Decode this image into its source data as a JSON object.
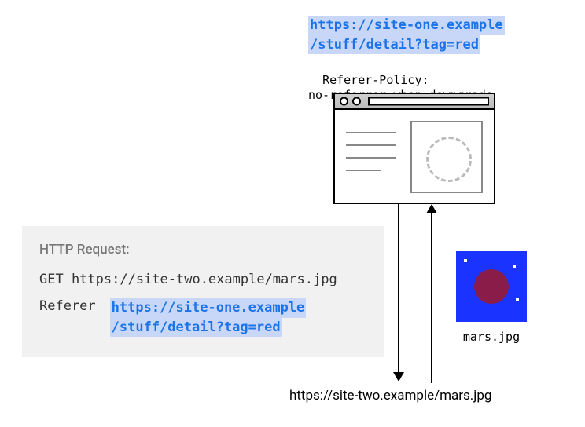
{
  "top": {
    "url_line1": "https://site-one.example",
    "url_line2": "/stuff/detail?tag=red",
    "policy_label": "Referer-Policy:",
    "policy_value": "no-referrer-when-downgrade"
  },
  "request": {
    "heading": "HTTP Request:",
    "method_line": "GET https://site-two.example/mars.jpg",
    "referer_label": "Referer",
    "referer_line1": "https://site-one.example",
    "referer_line2": "/stuff/detail?tag=red"
  },
  "image": {
    "caption": "mars.jpg"
  },
  "target_url": "https://site-two.example/mars.jpg"
}
